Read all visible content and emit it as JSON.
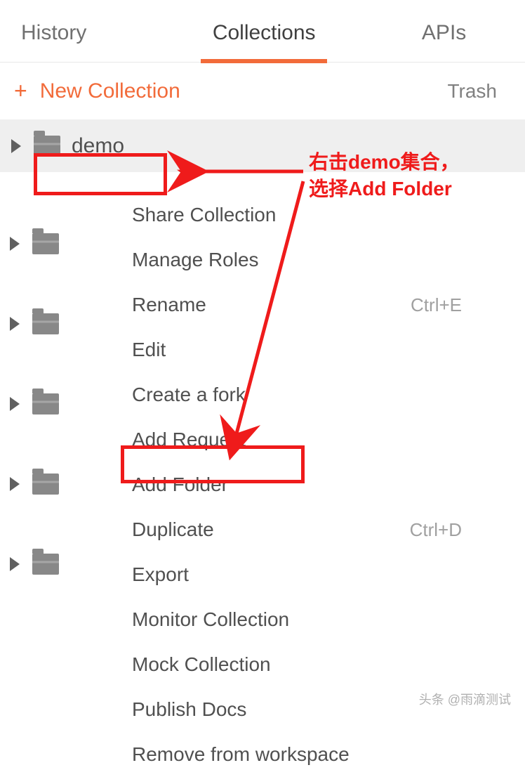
{
  "tabs": {
    "history": "History",
    "collections": "Collections",
    "apis": "APIs"
  },
  "actions": {
    "new_collection": "New Collection",
    "trash": "Trash"
  },
  "collection": {
    "demo_name": "demo"
  },
  "annotation": {
    "line1": "右击demo集合，",
    "line2": "选择Add Folder"
  },
  "menu": {
    "share": "Share Collection",
    "manage_roles": "Manage Roles",
    "rename": "Rename",
    "rename_shortcut": "Ctrl+E",
    "edit": "Edit",
    "create_fork": "Create a fork",
    "add_request": "Add Request",
    "add_folder": "Add Folder",
    "duplicate": "Duplicate",
    "duplicate_shortcut": "Ctrl+D",
    "export": "Export",
    "monitor": "Monitor Collection",
    "mock": "Mock Collection",
    "publish": "Publish Docs",
    "remove": "Remove from workspace"
  },
  "watermark": "头条 @雨滴测试"
}
